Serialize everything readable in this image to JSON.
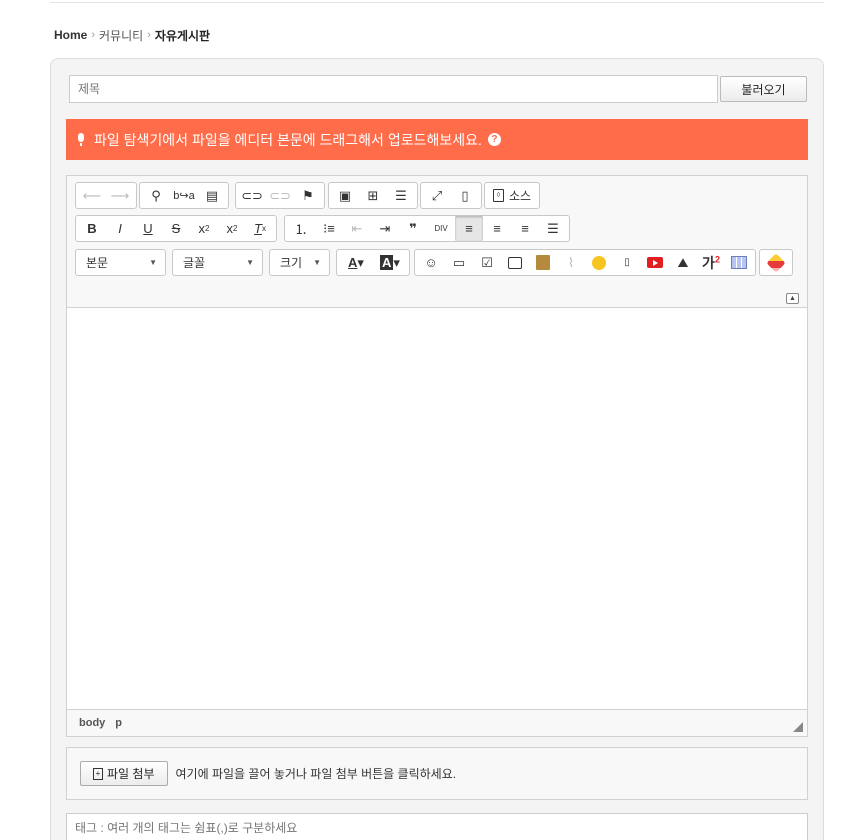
{
  "breadcrumb": {
    "home": "Home",
    "sep": "›",
    "community": "커뮤니티",
    "current": "자유게시판"
  },
  "form": {
    "title_placeholder": "제목",
    "load_button": "불러오기",
    "notice_text": "파일 탐색기에서 파일을 에디터 본문에 드래그해서 업로드해보세요.",
    "notice_help": "?"
  },
  "toolbar": {
    "row1": [
      [
        "undo-button",
        "↶",
        true
      ],
      [
        "redo-button",
        "↷",
        true
      ]
    ],
    "source_label": "소스",
    "format_combo": "본문",
    "font_combo": "글꼴",
    "size_combo": "크기"
  },
  "editor": {
    "path": [
      "body",
      "p"
    ]
  },
  "attach": {
    "button_label": "파일 첨부",
    "hint": "여기에 파일을 끌어 놓거나 파일 첨부 버튼을 클릭하세요."
  },
  "tags": {
    "placeholder": "태그 : 여러 개의 태그는 쉼표(,)로 구분하세요"
  },
  "colors": {
    "notice_bg": "#ff6c4a",
    "panel_bg": "#f4f4f4"
  },
  "icons": [
    "undo-icon",
    "redo-icon",
    "find-icon",
    "replace-icon",
    "select-all-icon",
    "link-icon",
    "unlink-icon",
    "anchor-icon",
    "image-icon",
    "table-icon",
    "horizontal-rule-icon",
    "maximize-icon",
    "show-blocks-icon",
    "source-icon",
    "bold-icon",
    "italic-icon",
    "underline-icon",
    "strike-icon",
    "subscript-icon",
    "superscript-icon",
    "remove-format-icon",
    "numbered-list-icon",
    "bulleted-list-icon",
    "outdent-icon",
    "indent-icon",
    "blockquote-icon",
    "div-icon",
    "align-left-icon",
    "align-center-icon",
    "align-right-icon",
    "justify-icon",
    "emoticon-icon",
    "image2-icon",
    "checkbox-icon",
    "gallery-icon",
    "book-icon",
    "clip-icon",
    "emoji-icon",
    "code-icon",
    "youtube-icon",
    "map-icon",
    "superscript-ga-icon",
    "columns-icon",
    "pencil-icon"
  ]
}
